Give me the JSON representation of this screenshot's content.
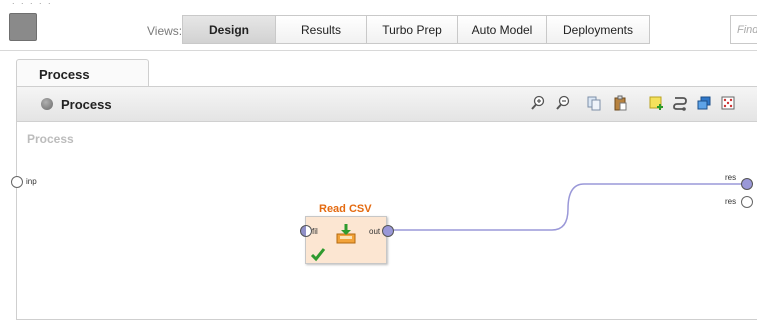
{
  "toolbar": {
    "views_label": "Views:",
    "tabs": [
      {
        "label": "Design",
        "active": true
      },
      {
        "label": "Results",
        "active": false
      },
      {
        "label": "Turbo Prep",
        "active": false
      },
      {
        "label": "Auto Model",
        "active": false
      },
      {
        "label": "Deployments",
        "active": false
      }
    ],
    "find_placeholder": "Find"
  },
  "process_panel": {
    "tab_label": "Process",
    "header_title": "Process",
    "header_icon": "process-circle-icon",
    "tools": [
      "zoom-in-icon",
      "zoom-out-icon",
      "copy-icon",
      "paste-icon",
      "add-note-icon",
      "auto-wire-icon",
      "arrange-layers-icon",
      "fit-view-icon"
    ],
    "canvas_label": "Process",
    "input_port_label": "inp",
    "output_port_labels": [
      "res",
      "res"
    ]
  },
  "operator": {
    "title": "Read CSV",
    "input_port": "fil",
    "output_port": "out",
    "icon": "read-csv-icon",
    "status_icon": "checkmark-icon",
    "accent": "#e46a10"
  },
  "colors": {
    "wire": "#9a98d8",
    "operator_fill": "#fce6d2",
    "active_tab": "#d8d8d8"
  }
}
